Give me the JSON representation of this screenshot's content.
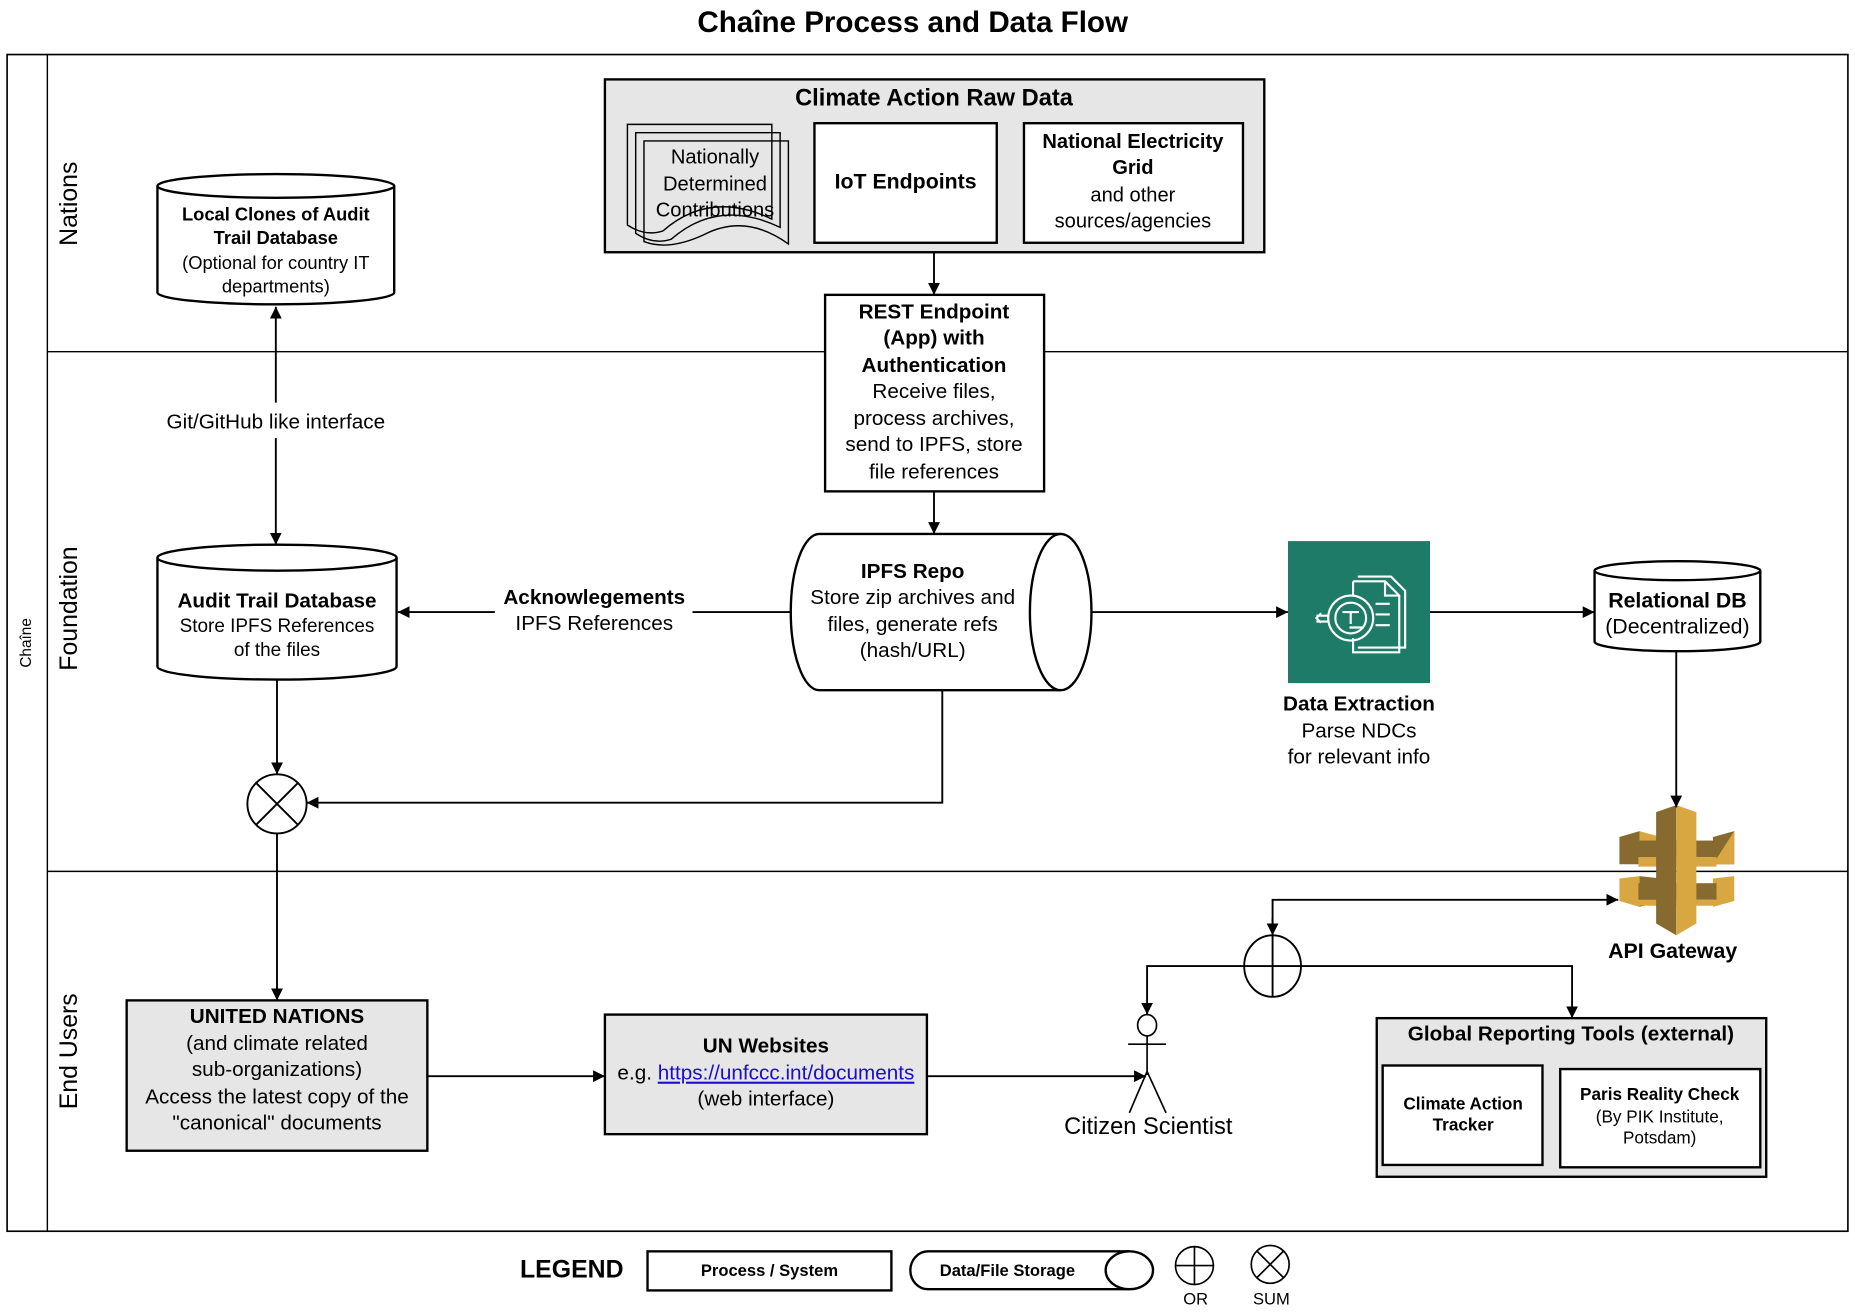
{
  "title": "Chaîne Process and Data Flow",
  "pool_label": "Chaîne",
  "lanes": [
    {
      "label": "Nations"
    },
    {
      "label": "Foundation"
    },
    {
      "label": "End Users"
    }
  ],
  "nodes": {
    "climate_raw": {
      "title": "Climate Action Raw Data",
      "ndc": [
        "Nationally",
        "Determined",
        "Contributions"
      ],
      "iot": "IoT Endpoints",
      "grid": {
        "bold": [
          "National Electricity",
          "Grid"
        ],
        "text": [
          "and other",
          "sources/agencies"
        ]
      }
    },
    "local_clones": {
      "bold": [
        "Local Clones of Audit",
        "Trail Database"
      ],
      "text": [
        "(Optional for country IT",
        "departments)"
      ]
    },
    "rest": {
      "bold": [
        "REST Endpoint",
        "(App) with",
        "Authentication"
      ],
      "text": [
        "Receive files,",
        "process archives,",
        "send to IPFS, store",
        "file references"
      ]
    },
    "audit": {
      "bold": "Audit Trail Database",
      "text": [
        "Store IPFS References",
        "of the files"
      ]
    },
    "ipfs": {
      "bold": "IPFS Repo",
      "text": [
        "Store zip archives and",
        "files, generate refs",
        "(hash/URL)"
      ]
    },
    "extraction": {
      "bold": "Data Extraction",
      "text": [
        "Parse NDCs",
        "for relevant info"
      ],
      "color": "#1e7b67"
    },
    "relational": {
      "bold": "Relational DB",
      "text": "(Decentralized)"
    },
    "api_gateway": {
      "label": "API Gateway",
      "color_light": "#d9a741",
      "color_dark": "#876a2f"
    },
    "un": {
      "bold": "UNITED NATIONS",
      "text": [
        "(and climate related",
        "sub-organizations)",
        "Access the latest copy of the",
        "\"canonical\" documents"
      ]
    },
    "un_web": {
      "bold": "UN Websites",
      "prefix": "e.g. ",
      "link": "https://unfccc.int/documents",
      "text": "(web interface)"
    },
    "citizen": {
      "label": "Citizen Scientist"
    },
    "global_tools": {
      "title": "Global Reporting Tools (external)",
      "cat": [
        "Climate Action",
        "Tracker"
      ],
      "prc_bold": "Paris Reality Check",
      "prc_text": [
        "(By PIK Institute,",
        "Potsdam)"
      ]
    }
  },
  "edges": {
    "git": "Git/GitHub like interface",
    "ack_bold": "Acknowlegements",
    "ack_text": "IPFS References"
  },
  "legend": {
    "title": "LEGEND",
    "process": "Process / System",
    "storage": "Data/File Storage",
    "or": "OR",
    "sum": "SUM"
  }
}
